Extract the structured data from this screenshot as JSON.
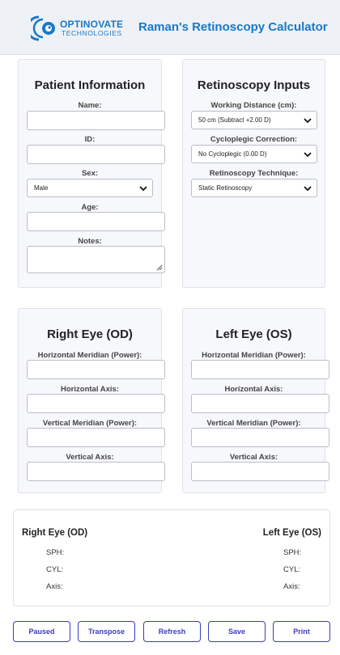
{
  "header": {
    "logo_word": "OPTINOVATE",
    "logo_sub": "TECHNOLOGIES",
    "app_title": "Raman's Retinoscopy Calculator",
    "brand_color": "#1a78c8"
  },
  "patient": {
    "title": "Patient Information",
    "name_label": "Name:",
    "id_label": "ID:",
    "sex_label": "Sex:",
    "sex_value": "Male",
    "age_label": "Age:",
    "notes_label": "Notes:"
  },
  "inputs": {
    "title": "Retinoscopy Inputs",
    "wd_label": "Working Distance (cm):",
    "wd_value": "50 cm (Subtract +2.00 D)",
    "cyclo_label": "Cycloplegic Correction:",
    "cyclo_value": "No Cycloplegic (0.00 D)",
    "tech_label": "Retinoscopy Technique:",
    "tech_value": "Static Retinoscopy"
  },
  "right_eye": {
    "title": "Right Eye (OD)",
    "h_power_label": "Horizontal Meridian (Power):",
    "h_axis_label": "Horizontal Axis:",
    "v_power_label": "Vertical Meridian (Power):",
    "v_axis_label": "Vertical Axis:"
  },
  "left_eye": {
    "title": "Left Eye (OS)",
    "h_power_label": "Horizontal Meridian (Power):",
    "h_axis_label": "Horizontal Axis:",
    "v_power_label": "Vertical Meridian (Power):",
    "v_axis_label": "Vertical Axis:"
  },
  "results": {
    "od_title": "Right Eye (OD)",
    "os_title": "Left Eye (OS)",
    "sph": "SPH:",
    "cyl": "CYL:",
    "axis": "Axis:"
  },
  "buttons": {
    "paused": "Paused",
    "transpose": "Transpose",
    "refresh": "Refresh",
    "save": "Save",
    "print": "Print",
    "accent": "#3b3dbd"
  }
}
